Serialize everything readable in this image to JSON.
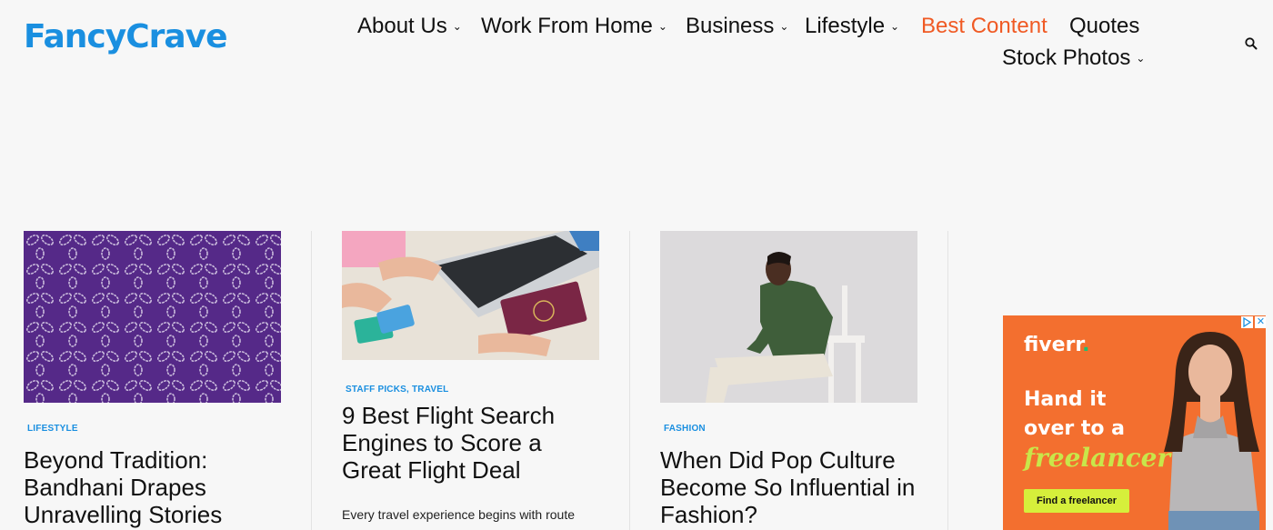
{
  "header": {
    "logo": "FancyCrave",
    "nav": [
      {
        "label": "About Us",
        "dropdown": true
      },
      {
        "label": "Work From Home",
        "dropdown": true
      },
      {
        "label": "Business",
        "dropdown": true
      },
      {
        "label": "Lifestyle",
        "dropdown": true
      },
      {
        "label": "Best Content",
        "dropdown": false,
        "active": true
      },
      {
        "label": "Quotes",
        "dropdown": false
      },
      {
        "label": "Stock Photos",
        "dropdown": true
      }
    ],
    "search_icon": "search-icon",
    "chevron_icon": "chevron-down-icon",
    "chevron_glyph": "⌄"
  },
  "posts": [
    {
      "category": "LIFESTYLE",
      "title": "Beyond Tradition: Bandhani Drapes Unravelling Stories",
      "excerpt": ""
    },
    {
      "category": "STAFF PICKS, TRAVEL",
      "title": "9 Best Flight Search Engines to Score a Great Flight Deal",
      "excerpt": "Every travel experience begins with route"
    },
    {
      "category": "FASHION",
      "title": "When Did Pop Culture Become So Influential in Fashion?",
      "excerpt": ""
    }
  ],
  "ad": {
    "brand": "fiverr",
    "brand_dot": ".",
    "line1": "Hand it",
    "line2": "over to a",
    "line3": "freelancer",
    "cta": "Find a freelancer",
    "close": "✕"
  },
  "colors": {
    "brand": "#1a8fe0",
    "active_nav": "#f05a24",
    "ad_bg": "#f36f2f",
    "ad_accent": "#c8e64a"
  }
}
